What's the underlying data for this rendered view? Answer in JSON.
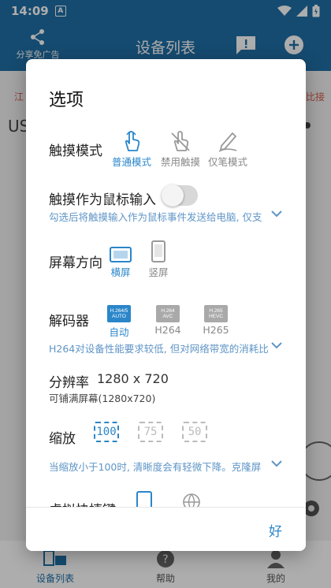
{
  "status_bar": {
    "time": "14:09",
    "a_badge": "A"
  },
  "app_bar": {
    "share_label": "分享免广告",
    "title": "设备列表"
  },
  "background": {
    "red_left": "江",
    "red_right": "比接",
    "device_text": "US"
  },
  "bottom_nav": {
    "items": [
      {
        "label": "设备列表"
      },
      {
        "label": "帮助"
      },
      {
        "label": "我的"
      }
    ]
  },
  "dialog": {
    "title": "选项",
    "touch_mode": {
      "label": "触摸模式",
      "options": [
        {
          "label": "普通模式",
          "selected": true
        },
        {
          "label": "禁用触摸",
          "selected": false
        },
        {
          "label": "仅笔模式",
          "selected": false
        }
      ]
    },
    "mouse_input": {
      "label": "触摸作为鼠标输入",
      "enabled": false,
      "hint": "勾选后将触摸输入作为鼠标事件发送给电脑, 仅支"
    },
    "orientation": {
      "label": "屏幕方向",
      "options": [
        {
          "label": "横屏",
          "selected": true
        },
        {
          "label": "竖屏",
          "selected": false
        }
      ]
    },
    "decoder": {
      "label": "解码器",
      "options": [
        {
          "label": "自动",
          "top": "H.264/5",
          "bottom": "AUTO",
          "selected": true
        },
        {
          "label": "H264",
          "top": "H.264",
          "bottom": "AVC",
          "selected": false
        },
        {
          "label": "H265",
          "top": "H.265",
          "bottom": "HEVC",
          "selected": false
        }
      ],
      "hint": "H264对设备性能要求较低, 但对网络带宽的消耗比"
    },
    "resolution": {
      "label": "分辨率",
      "value": "1280 x 720",
      "sub": "可铺满屏幕(1280x720)"
    },
    "zoom": {
      "label": "缩放",
      "options": [
        {
          "label": "100",
          "selected": true
        },
        {
          "label": "75",
          "selected": false
        },
        {
          "label": "50",
          "selected": false
        }
      ],
      "hint": "当缩放小于100时, 清晰度会有轻微下降。克隆屏"
    },
    "partial_row": {
      "label": "虚拟快捷键"
    },
    "ok_label": "好"
  },
  "colors": {
    "primary": "#1f6fa6",
    "accent": "#2a86c9",
    "hint": "#5f95c6"
  }
}
